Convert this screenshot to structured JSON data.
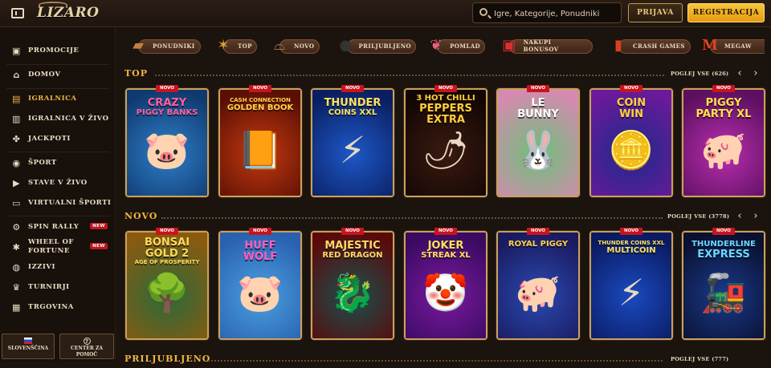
{
  "brand": {
    "logo_text": "LIZARO"
  },
  "header": {
    "search_placeholder": "Igre, Kategorije, Ponudniki",
    "login_label": "PRIJAVA",
    "register_label": "REGISTRACIJA"
  },
  "sidebar": {
    "items": [
      {
        "label": "PROMOCIJE",
        "icon": "gift-icon"
      },
      {
        "label": "DOMOV",
        "icon": "home-icon"
      },
      {
        "label": "IGRALNICA",
        "icon": "casino-icon",
        "active": true
      },
      {
        "label": "IGRALNICA V ŽIVO",
        "icon": "live-casino-icon"
      },
      {
        "label": "JACKPOTI",
        "icon": "jackpot-icon"
      },
      {
        "label": "ŠPORT",
        "icon": "sport-ball-icon"
      },
      {
        "label": "STAVE V ŽIVO",
        "icon": "play-icon"
      },
      {
        "label": "VIRTUALNI ŠPORTI",
        "icon": "virtual-sport-icon"
      },
      {
        "label": "SPIN RALLY",
        "icon": "spin-icon",
        "badge": "NEW"
      },
      {
        "label_line1": "WHEEL OF",
        "label_line2": "FORTUNE",
        "icon": "wheel-icon",
        "badge": "NEW"
      },
      {
        "label": "IZZIVI",
        "icon": "challenge-icon"
      },
      {
        "label": "TURNIRJI",
        "icon": "trophy-icon"
      },
      {
        "label": "TRGOVINA",
        "icon": "shop-icon"
      }
    ],
    "language_label": "SLOVENŠČINA",
    "help_label_line1": "CENTER ZA",
    "help_label_line2": "POMOČ"
  },
  "categories": [
    {
      "label": "PONUDNIKI",
      "icon": "chest-icon"
    },
    {
      "label": "TOP",
      "icon": "sheriff-star-icon"
    },
    {
      "label": "NOVO",
      "icon": "cowboy-hat-icon"
    },
    {
      "label": "PRILJUBLJENO",
      "icon": "bomb-icon"
    },
    {
      "label": "POMLAD",
      "icon": "butterfly-icon"
    },
    {
      "label": "NAKUPI BONUSOV",
      "icon": "gift-box-icon"
    },
    {
      "label": "CRASH GAMES",
      "icon": "dynamite-icon"
    },
    {
      "label": "MEGAW",
      "icon": "m-logo-icon"
    }
  ],
  "sections": [
    {
      "title": "TOP",
      "view_all": "POGLEJ VSE (626)",
      "games": [
        {
          "title_lines": [
            "CRAZY",
            "PIGGY BANKS"
          ],
          "badge": "NOVO",
          "bg": "#2f7fc9",
          "bg2": "#0f3a70",
          "title_color": "#ff5fa0",
          "emblem": "🐷"
        },
        {
          "title_lines": [
            "CASH CONNECTION",
            "GOLDEN BOOK"
          ],
          "badge": "NOVO",
          "bg": "#c43a0e",
          "bg2": "#5a0f05",
          "title_color": "#ffd24a",
          "emblem": "📙"
        },
        {
          "title_lines": [
            "THUNDER",
            "COINS XXL"
          ],
          "badge": "NOVO",
          "bg": "#1e58c9",
          "bg2": "#0a1f60",
          "title_color": "#ffe25a",
          "emblem": "⚡"
        },
        {
          "title_lines": [
            "3 HOT CHILLI",
            "PEPPERS",
            "EXTRA"
          ],
          "badge": "NOVO",
          "bg": "#3a1a10",
          "bg2": "#120604",
          "title_color": "#ffcf3a",
          "emblem": "🌶"
        },
        {
          "title_lines": [
            "LE",
            "BUNNY"
          ],
          "badge": "NOVO",
          "bg": "#6dbf7a",
          "bg2": "#d58ab0",
          "title_color": "#ffffff",
          "emblem": "🐰"
        },
        {
          "title_lines": [
            "COIN",
            "WIN"
          ],
          "badge": "NOVO",
          "bg": "#1d2a8a",
          "bg2": "#6a1a9a",
          "title_color": "#ffd33a",
          "emblem": "🪙"
        },
        {
          "title_lines": [
            "PIGGY",
            "PARTY XL"
          ],
          "badge": "NOVO",
          "bg": "#b82fae",
          "bg2": "#5c0f60",
          "title_color": "#ffe14a",
          "emblem": "🐖"
        }
      ]
    },
    {
      "title": "NOVO",
      "view_all": "POGLEJ VSE (3778)",
      "games": [
        {
          "title_lines": [
            "BONSAI",
            "GOLD 2",
            "AGE OF PROSPERITY"
          ],
          "badge": "NOVO",
          "bg": "#2a6a3a",
          "bg2": "#8a5a10",
          "title_color": "#ffd85a",
          "emblem": "🌳"
        },
        {
          "title_lines": [
            "HUFF",
            "WOLF"
          ],
          "badge": "NOVO",
          "bg": "#4aa0e0",
          "bg2": "#2a60b0",
          "title_color": "#ff5fbf",
          "emblem": "🐷"
        },
        {
          "title_lines": [
            "MAJESTIC",
            "RED DRAGON"
          ],
          "badge": "NOVO",
          "bg": "#1a5050",
          "bg2": "#5a0a0a",
          "title_color": "#ffd76a",
          "emblem": "🐉"
        },
        {
          "title_lines": [
            "JOKER",
            "STREAK XL"
          ],
          "badge": "NOVO",
          "bg": "#7a1aa0",
          "bg2": "#3a0a60",
          "title_color": "#ffe25a",
          "emblem": "🤡"
        },
        {
          "title_lines": [
            "ROYAL PIGGY"
          ],
          "badge": "NOVO",
          "bg": "#2a4ab0",
          "bg2": "#1a1a60",
          "title_color": "#ffd04a",
          "emblem": "🐖"
        },
        {
          "title_lines": [
            "THUNDER COINS XXL",
            "MULTICOIN"
          ],
          "badge": "NOVO",
          "bg": "#1a4ac0",
          "bg2": "#0a1a60",
          "title_color": "#ffe25a",
          "emblem": "⚡"
        },
        {
          "title_lines": [
            "THUNDERLINE",
            "EXPRESS"
          ],
          "badge": "NOVO",
          "bg": "#1a3a8a",
          "bg2": "#0a1030",
          "title_color": "#6ad8ff",
          "emblem": "🚂"
        }
      ]
    },
    {
      "title": "PRILJUBLJENO",
      "view_all": "POGLEJ VSE (777)",
      "games": []
    }
  ]
}
